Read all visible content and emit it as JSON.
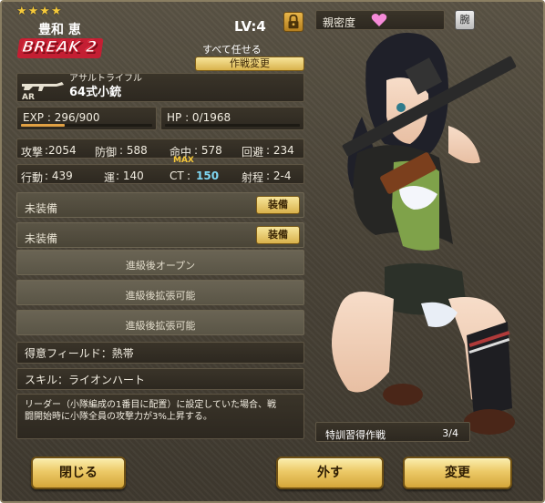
{
  "unit": {
    "stars": "★★★★",
    "name": "豊和 恵",
    "level": "LV:4",
    "break_label": "BREAK 2",
    "auto_label": "すべて任せる",
    "strategy_button": "作戦変更",
    "weapon_type": "アサルトライフル",
    "weapon_code": "AR",
    "weapon_name": "64式小銃",
    "exp": "EXP : 296/900",
    "exp_progress": 0.33,
    "hp": "HP : 0/1968",
    "hp_progress": 0.0
  },
  "stats": {
    "attack_label": "攻撃",
    "attack": ":2054",
    "defense_label": "防御",
    "defense": ": 588",
    "accuracy_label": "命中",
    "accuracy": ": 578",
    "evasion_label": "回避",
    "evasion": ": 234",
    "action_label": "行動",
    "action": ": 439",
    "luck_label": "運",
    "luck": ": 140",
    "ct_label": "CT",
    "ct_colon": ":",
    "ct": "150",
    "ct_max": "MAX",
    "range_label": "射程",
    "range": ": 2-4"
  },
  "equipment": [
    {
      "label": "未装備",
      "button": "装備"
    },
    {
      "label": "未装備",
      "button": "装備"
    }
  ],
  "locked_slots": [
    "進級後オープン",
    "進級後拡張可能",
    "進級後拡張可能"
  ],
  "field": "得意フィールド：熱帯",
  "skill": {
    "name": "スキル：ライオンハート",
    "description": "リーダー（小隊編成の1番目に配置）に設定していた場合、戦闘開始時に小隊全員の攻撃力が3%上昇する。"
  },
  "affinity": {
    "label": "親密度",
    "button": "腕"
  },
  "training": {
    "label": "特訓習得作戦",
    "value": "3/4"
  },
  "buttons": {
    "close": "閉じる",
    "remove": "外す",
    "change": "変更"
  },
  "colors": {
    "accent_gold": "#ecc967",
    "ct_blue": "#7fd7f2",
    "heart_pink": "#f58ad8",
    "break_red": "#c41f33"
  }
}
